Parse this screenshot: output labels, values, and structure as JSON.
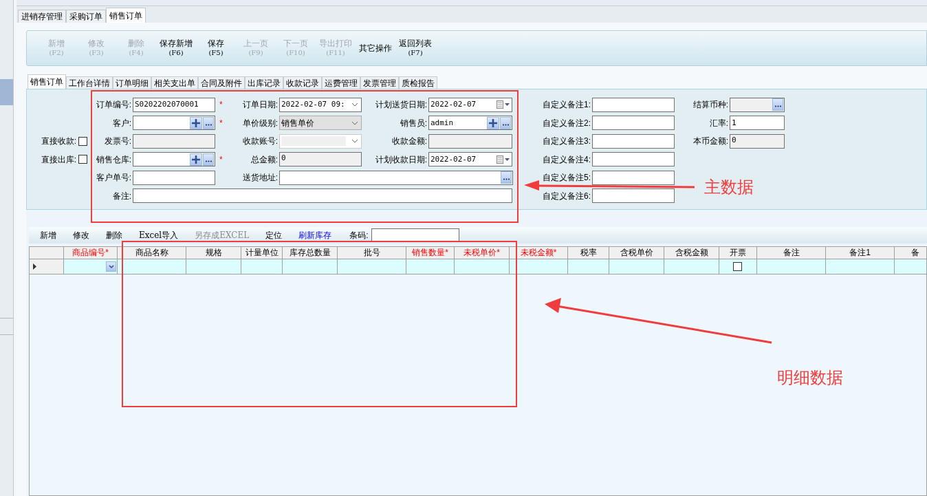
{
  "outer_tabs": [
    {
      "label": "进销存管理",
      "selected": false
    },
    {
      "label": "采购订单",
      "selected": false
    },
    {
      "label": "销售订单",
      "selected": true
    }
  ],
  "toolbar": [
    {
      "label": "新增",
      "shortcut": "(F2)",
      "disabled": true
    },
    {
      "label": "修改",
      "shortcut": "(F3)",
      "disabled": true
    },
    {
      "label": "删除",
      "shortcut": "(F4)",
      "disabled": true
    },
    {
      "label": "保存新增",
      "shortcut": "(F6)",
      "disabled": false
    },
    {
      "label": "保存",
      "shortcut": "(F5)",
      "disabled": false
    },
    {
      "label": "上一页",
      "shortcut": "(F9)",
      "disabled": true
    },
    {
      "label": "下一页",
      "shortcut": "(F10)",
      "disabled": true
    },
    {
      "label": "导出打印",
      "shortcut": "(F11)",
      "disabled": true
    },
    {
      "label": "其它操作",
      "disabled": false
    },
    {
      "label": "返回列表",
      "shortcut": "(F7)",
      "disabled": false
    }
  ],
  "inner_tabs": [
    {
      "label": "销售订单",
      "selected": true
    },
    {
      "label": "工作台详情",
      "selected": false
    },
    {
      "label": "订单明细",
      "selected": false
    },
    {
      "label": "相关支出单",
      "selected": false
    },
    {
      "label": "合同及附件",
      "selected": false
    },
    {
      "label": "出库记录",
      "selected": false
    },
    {
      "label": "收款记录",
      "selected": false
    },
    {
      "label": "运费管理",
      "selected": false
    },
    {
      "label": "发票管理",
      "selected": false
    },
    {
      "label": "质检报告",
      "selected": false
    }
  ],
  "form": {
    "rows": [
      {
        "main": {
          "label": "订单编号:",
          "kind": "text",
          "value": "S0202202070001",
          "marker": "*"
        },
        "second": {
          "label": "订单日期:",
          "kind": "datetime",
          "value": "2022-02-07 09:"
        },
        "third": {
          "label": "计划送货日期:",
          "kind": "date",
          "value": "2022-02-07"
        },
        "custom": {
          "label": "自定义备注1:",
          "kind": "text"
        },
        "extra": {
          "label": "结算币种:",
          "kind": "currency"
        }
      },
      {
        "main": {
          "label": "客户:",
          "kind": "lookup",
          "marker": "*"
        },
        "second": {
          "label": "单价级别:",
          "kind": "select",
          "value": "销售单价"
        },
        "third": {
          "label": "销售员:",
          "kind": "lookup",
          "value": "admin"
        },
        "custom": {
          "label": "自定义备注2:",
          "kind": "text"
        },
        "extra": {
          "label": "汇率:",
          "kind": "text",
          "value": "1"
        }
      },
      {
        "left": {
          "label": "直接收款:",
          "checked": false
        },
        "main": {
          "label": "发票号:",
          "kind": "readonly"
        },
        "second": {
          "label": "收款账号:",
          "kind": "disabled_select"
        },
        "third": {
          "label": "收款金额:",
          "kind": "readonly"
        },
        "custom": {
          "label": "自定义备注3:",
          "kind": "text"
        },
        "extra": {
          "label": "本币金额:",
          "kind": "readonly",
          "value": "0"
        }
      },
      {
        "left": {
          "label": "直接出库:",
          "checked": false
        },
        "main": {
          "label": "销售仓库:",
          "kind": "lookup",
          "marker": "*"
        },
        "second": {
          "label": "总金额:",
          "kind": "readonly",
          "value": "0"
        },
        "third": {
          "label": "计划收款日期:",
          "kind": "date",
          "value": "2022-02-07"
        },
        "custom": {
          "label": "自定义备注4:",
          "kind": "text"
        }
      },
      {
        "main": {
          "label": "客户单号:",
          "kind": "text"
        },
        "second": {
          "label": "送货地址:",
          "kind": "address"
        },
        "custom": {
          "label": "自定义备注5:",
          "kind": "text"
        }
      },
      {
        "main": {
          "label": "备注:",
          "kind": "note"
        },
        "custom": {
          "label": "自定义备注6:",
          "kind": "text"
        }
      }
    ]
  },
  "detail_toolbar": {
    "items": [
      {
        "label": "新增",
        "kind": "button",
        "disabled": false
      },
      {
        "label": "修改",
        "kind": "button",
        "disabled": false
      },
      {
        "label": "删除",
        "kind": "button",
        "disabled": false
      },
      {
        "label": "Excel导入",
        "kind": "button",
        "disabled": false
      },
      {
        "label": "另存成EXCEL",
        "kind": "button",
        "disabled": true
      },
      {
        "label": "定位",
        "kind": "button",
        "disabled": false
      },
      {
        "label": "刷新库存",
        "kind": "link",
        "disabled": false
      }
    ],
    "barcode": {
      "label": "条码:"
    }
  },
  "grid": {
    "columns": [
      {
        "label": "商品编号*",
        "required": true
      },
      {
        "label": "商品名称",
        "required": false
      },
      {
        "label": "规格",
        "required": false
      },
      {
        "label": "计量单位",
        "required": false
      },
      {
        "label": "库存总数量",
        "required": false
      },
      {
        "label": "批号",
        "required": false
      },
      {
        "label": "销售数量*",
        "required": true
      },
      {
        "label": "未税单价*",
        "required": true
      },
      {
        "label": "未税金额*",
        "required": true
      },
      {
        "label": "税率",
        "required": false
      },
      {
        "label": "含税单价",
        "required": false
      },
      {
        "label": "含税金额",
        "required": false
      },
      {
        "label": "开票",
        "required": false
      },
      {
        "label": "备注",
        "required": false
      },
      {
        "label": "备注1",
        "required": false
      },
      {
        "label": "备",
        "required": false
      }
    ],
    "rows": [
      {
        "current": true,
        "invoice": false
      }
    ]
  },
  "annotations": {
    "labels": [
      "主数据",
      "明细数据"
    ]
  }
}
